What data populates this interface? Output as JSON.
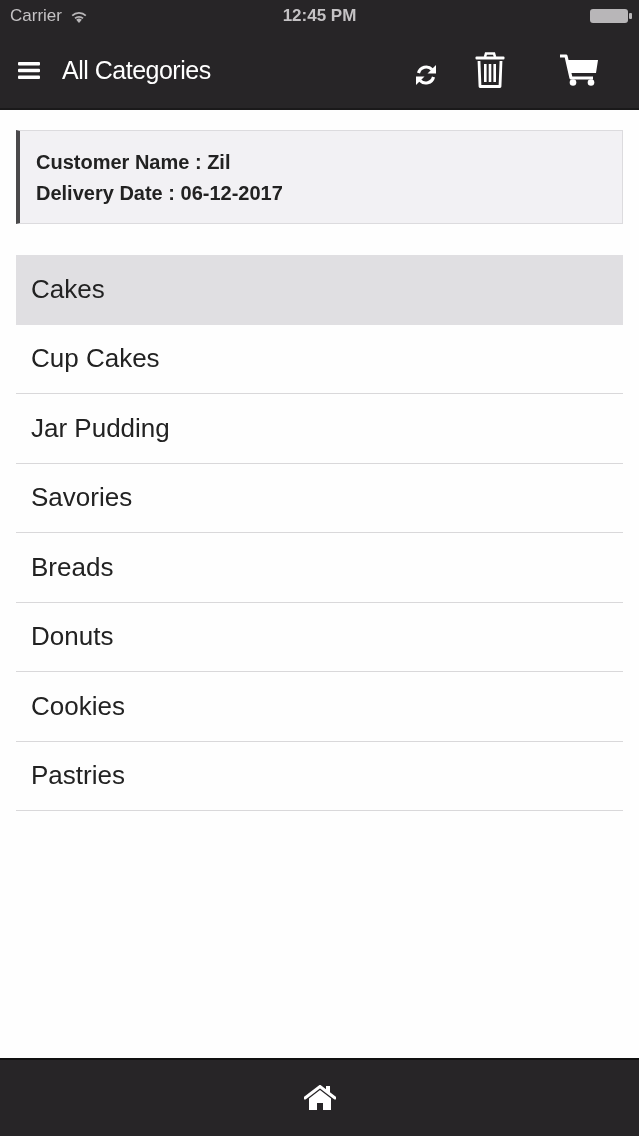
{
  "status_bar": {
    "carrier": "Carrier",
    "time": "12:45 PM"
  },
  "nav_bar": {
    "title": "All Categories"
  },
  "order_info": {
    "lines": [
      "Customer Name : Zil",
      "Delivery Date : 06-12-2017"
    ]
  },
  "categories": [
    {
      "label": "Cakes",
      "selected": true
    },
    {
      "label": "Cup Cakes",
      "selected": false
    },
    {
      "label": "Jar Pudding",
      "selected": false
    },
    {
      "label": "Savories",
      "selected": false
    },
    {
      "label": "Breads",
      "selected": false
    },
    {
      "label": "Donuts",
      "selected": false
    },
    {
      "label": "Cookies",
      "selected": false
    },
    {
      "label": "Pastries",
      "selected": false
    }
  ]
}
